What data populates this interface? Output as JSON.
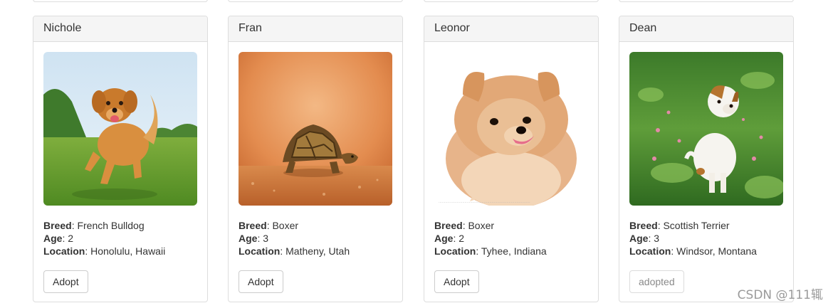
{
  "labels": {
    "breed": "Breed",
    "age": "Age",
    "location": "Location"
  },
  "pets": [
    {
      "name": "Nichole",
      "breed": "French Bulldog",
      "age": "2",
      "location": "Honolulu, Hawaii",
      "action": "Adopt",
      "adopted": false,
      "image": "golden-retriever-running-photo"
    },
    {
      "name": "Fran",
      "breed": "Boxer",
      "age": "3",
      "location": "Matheny, Utah",
      "action": "Adopt",
      "adopted": false,
      "image": "tortoise-photo"
    },
    {
      "name": "Leonor",
      "breed": "Boxer",
      "age": "2",
      "location": "Tyhee, Indiana",
      "action": "Adopt",
      "adopted": false,
      "image": "pomeranian-photo"
    },
    {
      "name": "Dean",
      "breed": "Scottish Terrier",
      "age": "3",
      "location": "Windsor, Montana",
      "action": "adopted",
      "adopted": true,
      "image": "puppy-in-grass-photo"
    }
  ],
  "watermark": "CSDN @111辄",
  "colors": {
    "panel_border": "#dddddd",
    "heading_bg": "#f5f5f5",
    "text": "#333333",
    "disabled_text": "#8a8a8a"
  }
}
